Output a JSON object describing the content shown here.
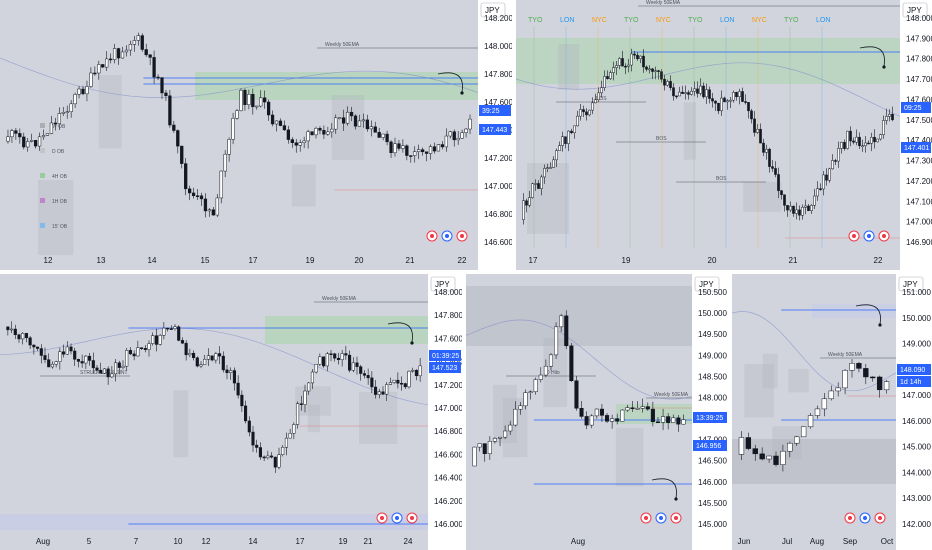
{
  "chart_data": [
    {
      "type": "candlestick",
      "currency_label": "JPY",
      "price_ticks": [
        148.2,
        148.0,
        147.8,
        147.6,
        147.4,
        147.2,
        147.0,
        146.8,
        146.6
      ],
      "date_ticks": [
        "12",
        "13",
        "14",
        "15",
        "17",
        "19",
        "20",
        "21",
        "22"
      ],
      "last_price": "147.443",
      "countdown": "39:25",
      "legend_items": [
        "W OB",
        "D OB",
        "4H OB",
        "1H OB",
        "15' OB"
      ],
      "annotations": [
        "Weekly 50EMA"
      ],
      "colors": {
        "zone_green": "#a5d6a7",
        "line_blue": "#2962ff",
        "line_red": "#ef9a9a"
      }
    },
    {
      "type": "candlestick",
      "currency_label": "JPY",
      "price_ticks": [
        148.0,
        147.9,
        147.8,
        147.7,
        147.6,
        147.5,
        147.4,
        147.3,
        147.2,
        147.1,
        147.0,
        146.9
      ],
      "date_ticks": [
        "17",
        "19",
        "20",
        "21",
        "22"
      ],
      "last_price": "147.401",
      "countdown": "09:25",
      "sessions": [
        {
          "label": "TYO",
          "color": "#4caf50"
        },
        {
          "label": "LON",
          "color": "#2196f3"
        },
        {
          "label": "NYC",
          "color": "#ff9800"
        },
        {
          "label": "TYO",
          "color": "#4caf50"
        },
        {
          "label": "NYC",
          "color": "#ff9800"
        },
        {
          "label": "TYO",
          "color": "#4caf50"
        },
        {
          "label": "LON",
          "color": "#2196f3"
        },
        {
          "label": "NYC",
          "color": "#ff9800"
        },
        {
          "label": "TYO",
          "color": "#4caf50"
        },
        {
          "label": "LON",
          "color": "#2196f3"
        }
      ],
      "annotations": [
        "Weekly 50EMA",
        "BOS",
        "BOS",
        "BOS"
      ]
    },
    {
      "type": "candlestick",
      "currency_label": "JPY",
      "price_ticks": [
        148.0,
        147.8,
        147.6,
        147.4,
        147.2,
        147.0,
        146.8,
        146.6,
        146.4,
        146.2,
        146.0
      ],
      "date_ticks": [
        "Aug",
        "5",
        "7",
        "10",
        "12",
        "14",
        "17",
        "19",
        "21",
        "24"
      ],
      "last_price": "147.523",
      "countdown": "01:39:25",
      "annotations": [
        "Weekly 50EMA",
        "STRUCTURE POINT"
      ]
    },
    {
      "type": "candlestick",
      "currency_label": "JPY",
      "price_ticks": [
        150.5,
        150.0,
        149.5,
        149.0,
        148.5,
        148.0,
        147.5,
        147.0,
        146.5,
        146.0,
        145.5,
        145.0
      ],
      "date_ticks": [
        "Aug"
      ],
      "last_price": "146.956",
      "countdown": "13:39:25",
      "annotations": [
        "Weekly 50EMA",
        "D Hilo"
      ]
    },
    {
      "type": "candlestick",
      "currency_label": "JPY",
      "price_ticks": [
        151.0,
        150.0,
        149.0,
        148.0,
        147.0,
        146.0,
        145.0,
        144.0,
        143.0,
        142.0
      ],
      "date_ticks": [
        "Jun",
        "Jul",
        "Aug",
        "Sep",
        "Oct"
      ],
      "last_price": "148.090",
      "countdown": "1d 14h",
      "annotations": [
        "Weekly 50EMA"
      ]
    }
  ]
}
